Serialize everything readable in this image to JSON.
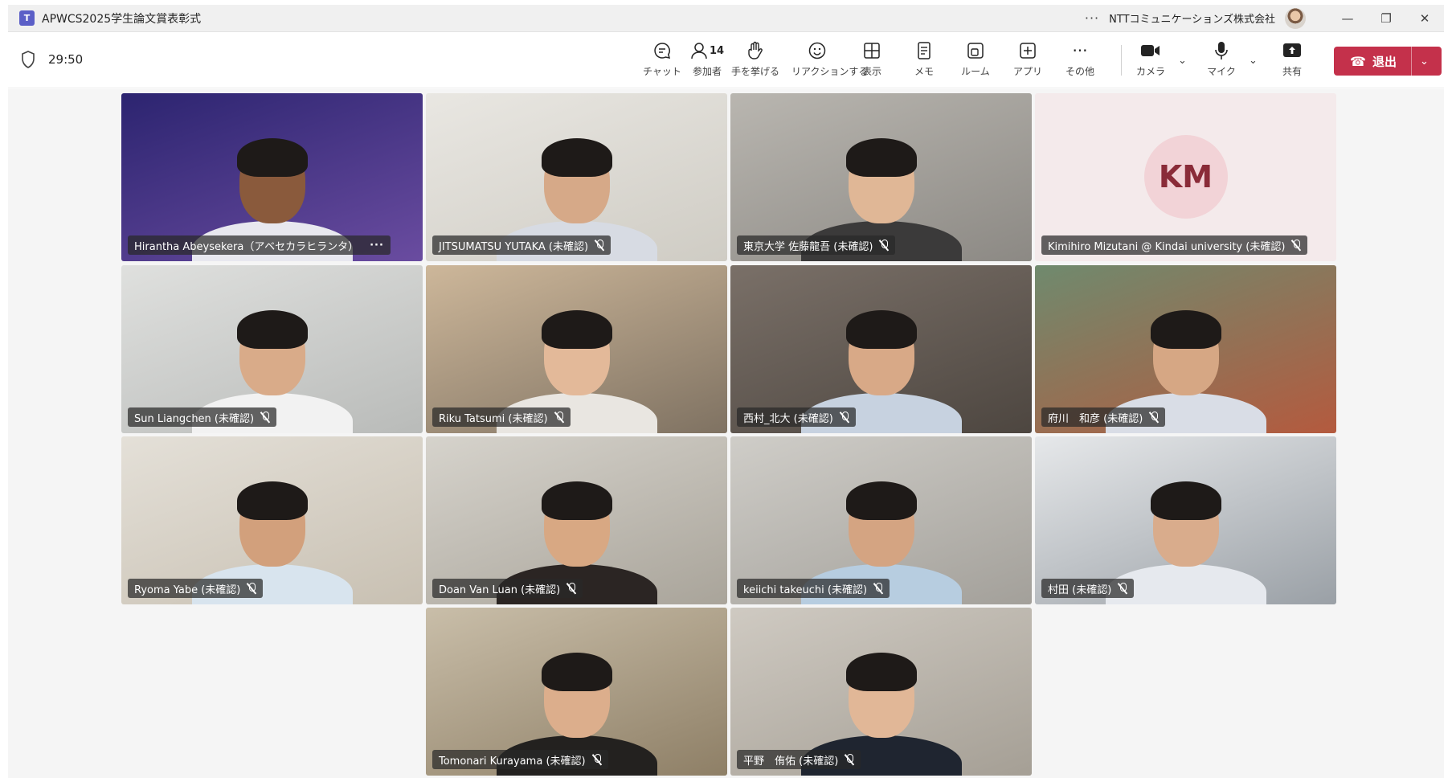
{
  "window": {
    "title": "APWCS2025学生論文賞表彰式",
    "logo_text": "T",
    "overflow": "···",
    "organization": "NTTコミュニケーションズ株式会社",
    "minimize": "—",
    "restore": "❐",
    "close": "✕"
  },
  "toolbar": {
    "timer": "29:50",
    "buttons": [
      {
        "icon": "chat-icon",
        "label": "チャット"
      },
      {
        "icon": "people-icon",
        "label": "参加者",
        "count": "14"
      },
      {
        "icon": "raise-hand-icon",
        "label": "手を挙げる"
      },
      {
        "icon": "reaction-icon",
        "label": "リアクションする"
      },
      {
        "icon": "view-icon",
        "label": "表示"
      },
      {
        "icon": "notes-icon",
        "label": "メモ"
      },
      {
        "icon": "rooms-icon",
        "label": "ルーム"
      },
      {
        "icon": "apps-icon",
        "label": "アプリ"
      },
      {
        "icon": "more-icon",
        "label": "その他"
      },
      {
        "icon": "camera-icon",
        "label": "カメラ"
      },
      {
        "icon": "mic-icon",
        "label": "マイク"
      },
      {
        "icon": "share-icon",
        "label": "共有"
      }
    ],
    "leave_label": "退出"
  },
  "participants": [
    {
      "name": "Hirantha Abeysekera（アベセカラヒランタ）",
      "muted": false,
      "more": "···",
      "bg": "#2c2470",
      "bg2": "#6a4ca0",
      "shirt": "#e8e8ef",
      "skin": "#8a5a3c"
    },
    {
      "name": "JITSUMATSU YUTAKA (未確認)",
      "muted": true,
      "bg": "#e9e7e2",
      "bg2": "#cfccc4",
      "shirt": "#d7dbe3",
      "skin": "#d6a988"
    },
    {
      "name": "東京大学 佐藤龍吾 (未確認)",
      "muted": true,
      "bg": "#b9b6b0",
      "bg2": "#8c8984",
      "shirt": "#3b3a3a",
      "skin": "#e0b796"
    },
    {
      "name": "Kimihiro Mizutani @ Kindai university (未確認)",
      "muted": true,
      "initials": "KM",
      "bg": "#f4eaeb",
      "bg2": "#f4eaeb"
    },
    {
      "name": "Sun Liangchen (未確認)",
      "muted": true,
      "bg": "#dfe0de",
      "bg2": "#b9bbb9",
      "shirt": "#f2f2f2",
      "skin": "#d9ab89"
    },
    {
      "name": "Riku Tatsumi (未確認)",
      "muted": true,
      "bg": "#cdb79a",
      "bg2": "#7f7262",
      "shirt": "#e9e6e1",
      "skin": "#e3b999"
    },
    {
      "name": "西村_北大 (未確認)",
      "muted": true,
      "bg": "#7a7068",
      "bg2": "#4d4640",
      "shirt": "#c7d2e0",
      "skin": "#d8a987"
    },
    {
      "name": "府川　和彦 (未確認)",
      "muted": true,
      "bg": "#6f8a6e",
      "bg2": "#b45a3e",
      "shirt": "#d9dde6",
      "skin": "#d6a784"
    },
    {
      "name": "Ryoma Yabe (未確認)",
      "muted": true,
      "bg": "#e4e0d8",
      "bg2": "#c8c0b2",
      "shirt": "#d8e4ee",
      "skin": "#d2a07c"
    },
    {
      "name": "Doan Van Luan (未確認)",
      "muted": true,
      "bg": "#d6d3cc",
      "bg2": "#a9a49a",
      "shirt": "#2b2523",
      "skin": "#d8a883"
    },
    {
      "name": "keiichi takeuchi (未確認)",
      "muted": true,
      "bg": "#cfcdc8",
      "bg2": "#a3a09a",
      "shirt": "#b7cde0",
      "skin": "#d4a482"
    },
    {
      "name": "村田 (未確認)",
      "muted": true,
      "bg": "#e6e8ea",
      "bg2": "#9aa0a6",
      "shirt": "#e6e9ee",
      "skin": "#d9ac8c"
    },
    {
      "name": "Tomonari Kurayama (未確認)",
      "muted": true,
      "bg": "#c9bea9",
      "bg2": "#8e7f66",
      "shirt": "#23211f",
      "skin": "#dcae8c"
    },
    {
      "name": "平野　侑佑 (未確認)",
      "muted": true,
      "bg": "#cfcac2",
      "bg2": "#a59f95",
      "shirt": "#1f2530",
      "skin": "#e1b797"
    }
  ]
}
